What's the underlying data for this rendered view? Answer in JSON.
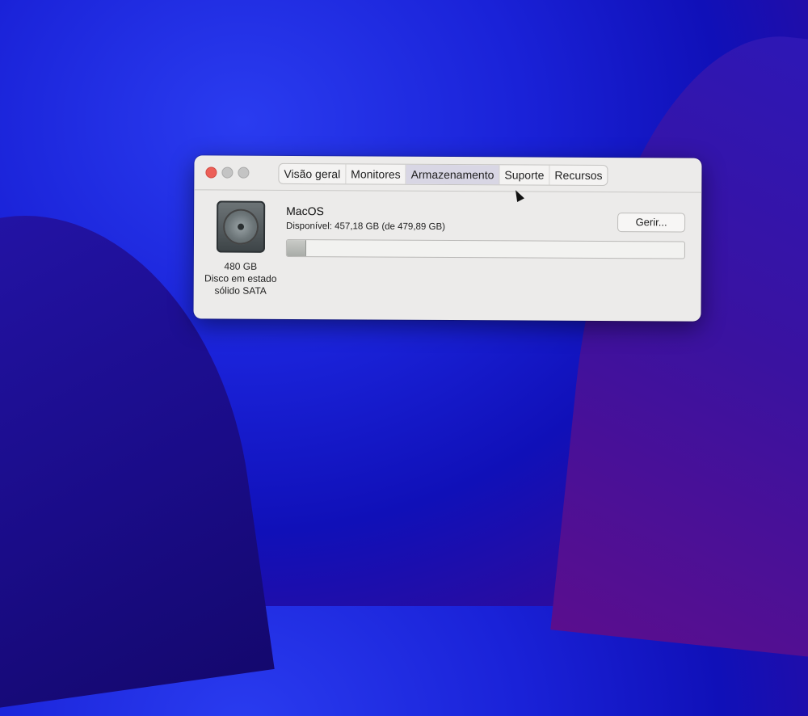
{
  "window": {
    "tabs": [
      {
        "label": "Visão geral"
      },
      {
        "label": "Monitores"
      },
      {
        "label": "Armazenamento"
      },
      {
        "label": "Suporte"
      },
      {
        "label": "Recursos"
      }
    ],
    "active_tab_index": 2
  },
  "disk": {
    "size": "480 GB",
    "description": "Disco em estado sólido SATA",
    "icon": "internal-drive-icon"
  },
  "volume": {
    "name": "MacOS",
    "available_text": "Disponível: 457,18 GB (de 479,89 GB)",
    "used_fraction": 0.047
  },
  "manage_button": {
    "label": "Gerir..."
  },
  "colors": {
    "close": "#ec5f57",
    "active_tab": "#d8d6e4",
    "window_bg": "#ecebea"
  }
}
